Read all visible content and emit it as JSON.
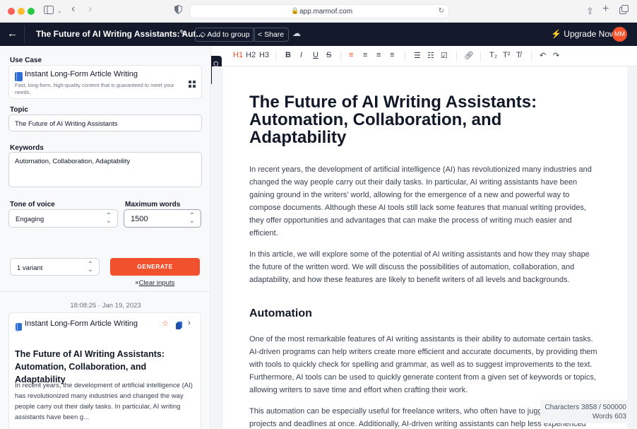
{
  "browser": {
    "url": "app.marmof.com"
  },
  "header": {
    "document_title": "The Future of AI Writing Assistants: Aut...",
    "add_to_group": "Add to group",
    "share": "Share",
    "upgrade": "Upgrade Now",
    "avatar_initials": "MM"
  },
  "form": {
    "use_case_label": "Use Case",
    "use_case_title": "Instant Long-Form Article Writing",
    "use_case_desc": "Fast, long-form, high-quality content that is guaranteed to meet your needs.",
    "topic_label": "Topic",
    "topic_value": "The Future of AI Writing Assistants",
    "keywords_label": "Keywords",
    "keywords_value": "Automation, Collaboration, Adaptability",
    "tone_label": "Tone of voice",
    "tone_value": "Engaging",
    "max_words_label": "Maximum words",
    "max_words_value": "1500",
    "variants_value": "1 variant",
    "generate": "GENERATE",
    "clear_inputs": "Clear inputs"
  },
  "history": {
    "timestamp": "18:08:25 · Jan 19, 2023",
    "use_case": "Instant Long-Form Article Writing",
    "title": "The Future of AI Writing Assistants: Automation, Collaboration, and Adaptability",
    "excerpt": "In recent years, the development of artificial intelligence (AI) has revolutionized many industries and changed the way people carry out their daily tasks. In particular, AI writing assistants have been g..."
  },
  "sidebar_toggle": "Close",
  "toolbar": {
    "h1": "H1",
    "h2": "H2",
    "h3": "H3",
    "bold": "B",
    "italic": "I",
    "underline": "U",
    "strike": "S"
  },
  "editor": {
    "title": "The Future of AI Writing Assistants: Automation, Collaboration, and Adaptability",
    "p1": "In recent years, the development of artificial intelligence (AI) has revolutionized many industries and changed the way people carry out their daily tasks. In particular, AI writing assistants have been gaining ground in the writers' world, allowing for the emergence of a new and powerful way to compose documents. Although these AI tools still lack some features that manual writing provides, they offer opportunities and advantages that can make the process of writing much easier and efficient.",
    "p2": "In this article, we will explore some of the potential of AI writing assistants and how they may shape the future of the written word. We will discuss the possibilities of automation, collaboration, and adaptability, and how these features are likely to benefit writers of all levels and backgrounds.",
    "h2": "Automation",
    "p3": "One of the most remarkable features of AI writing assistants is their ability to automate certain tasks. AI-driven programs can help writers create more efficient and accurate documents, by providing them with tools to quickly check for spelling and grammar, as well as to suggest improvements to the text. Furthermore, AI tools can be used to quickly generate content from a given set of keywords or topics, allowing writers to save time and effort when crafting their work.",
    "p4": "This automation can be especially useful for freelance writers, who often have to juggle multiple projects and deadlines at once. Additionally, AI-driven writing assistants can help less experienced"
  },
  "stats": {
    "characters": "Characters 3858 / 500000",
    "words": "Words 603"
  },
  "colors": {
    "accent": "#f2512d",
    "header_bg": "#141a2b"
  }
}
